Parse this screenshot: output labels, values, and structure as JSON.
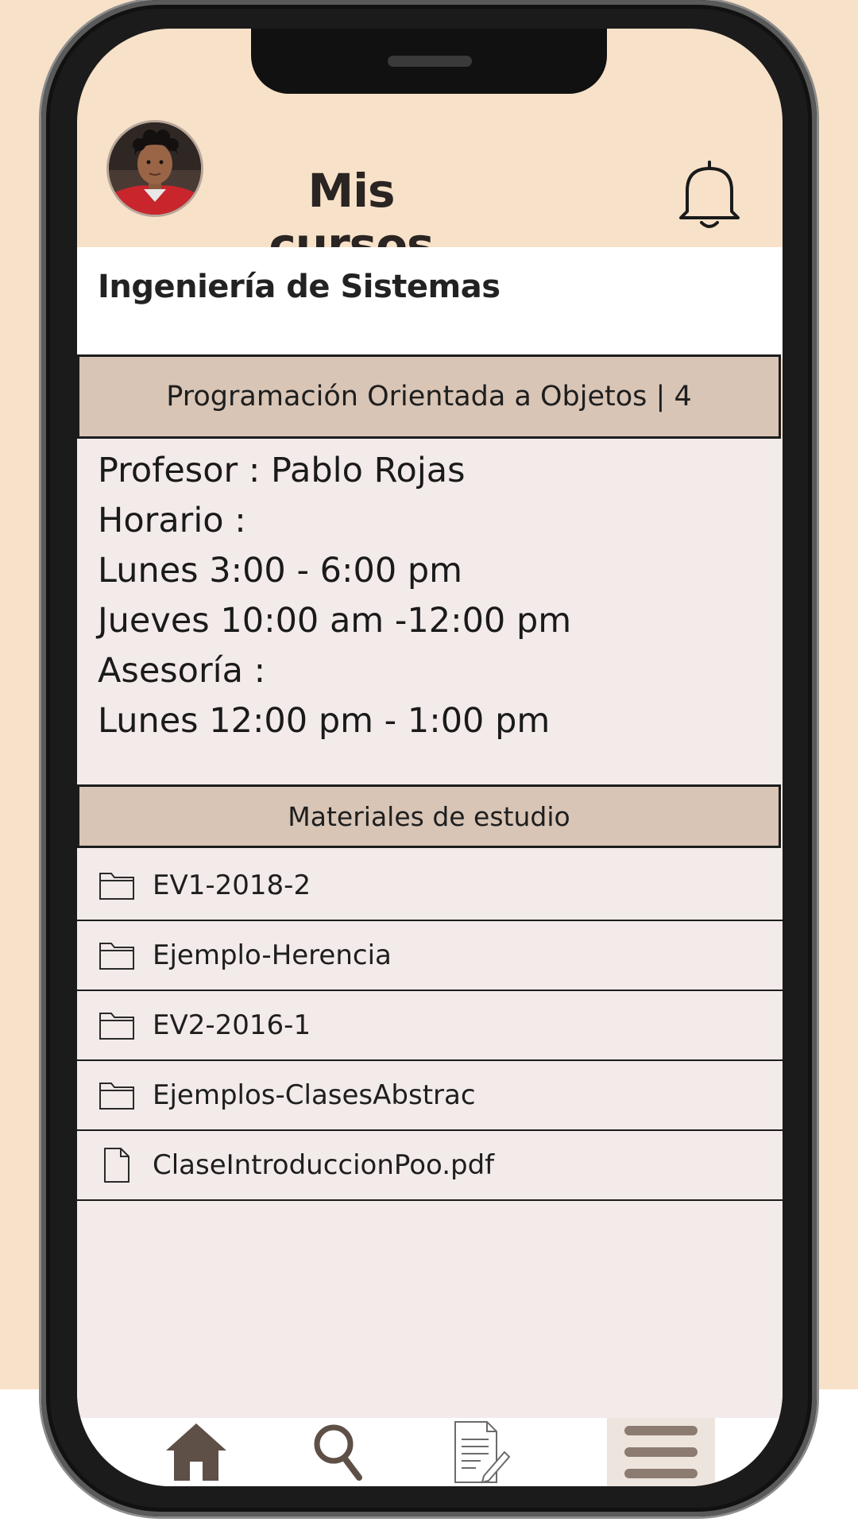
{
  "header": {
    "title": "Mis cursos",
    "avatar_icon": "profile-photo",
    "notification_icon": "bell-icon"
  },
  "program": {
    "title": "Ingeniería de Sistemas"
  },
  "course": {
    "header": "Programación Orientada a Objetos | 4",
    "lines": [
      "Profesor : Pablo Rojas",
      "Horario :",
      "Lunes 3:00 - 6:00 pm",
      "Jueves 10:00 am -12:00 pm",
      "Asesoría :",
      "Lunes 12:00 pm - 1:00 pm"
    ]
  },
  "materials": {
    "header": "Materiales de estudio",
    "items": [
      {
        "label": "EV1-2018-2",
        "icon": "folder-icon"
      },
      {
        "label": "Ejemplo-Herencia",
        "icon": "folder-icon"
      },
      {
        "label": "EV2-2016-1",
        "icon": "folder-icon"
      },
      {
        "label": "Ejemplos-ClasesAbstrac",
        "icon": "folder-icon"
      },
      {
        "label": "ClaseIntroduccionPoo.pdf",
        "icon": "file-icon"
      }
    ]
  },
  "nav": {
    "items": [
      "home-icon",
      "search-icon",
      "document-edit-icon",
      "menu-icon"
    ],
    "active": "menu-icon"
  },
  "colors": {
    "background": "#f7e1c8",
    "section_header": "#d8c5b6",
    "content_bg": "#f3eaea",
    "nav_icon": "#5e4f47"
  }
}
